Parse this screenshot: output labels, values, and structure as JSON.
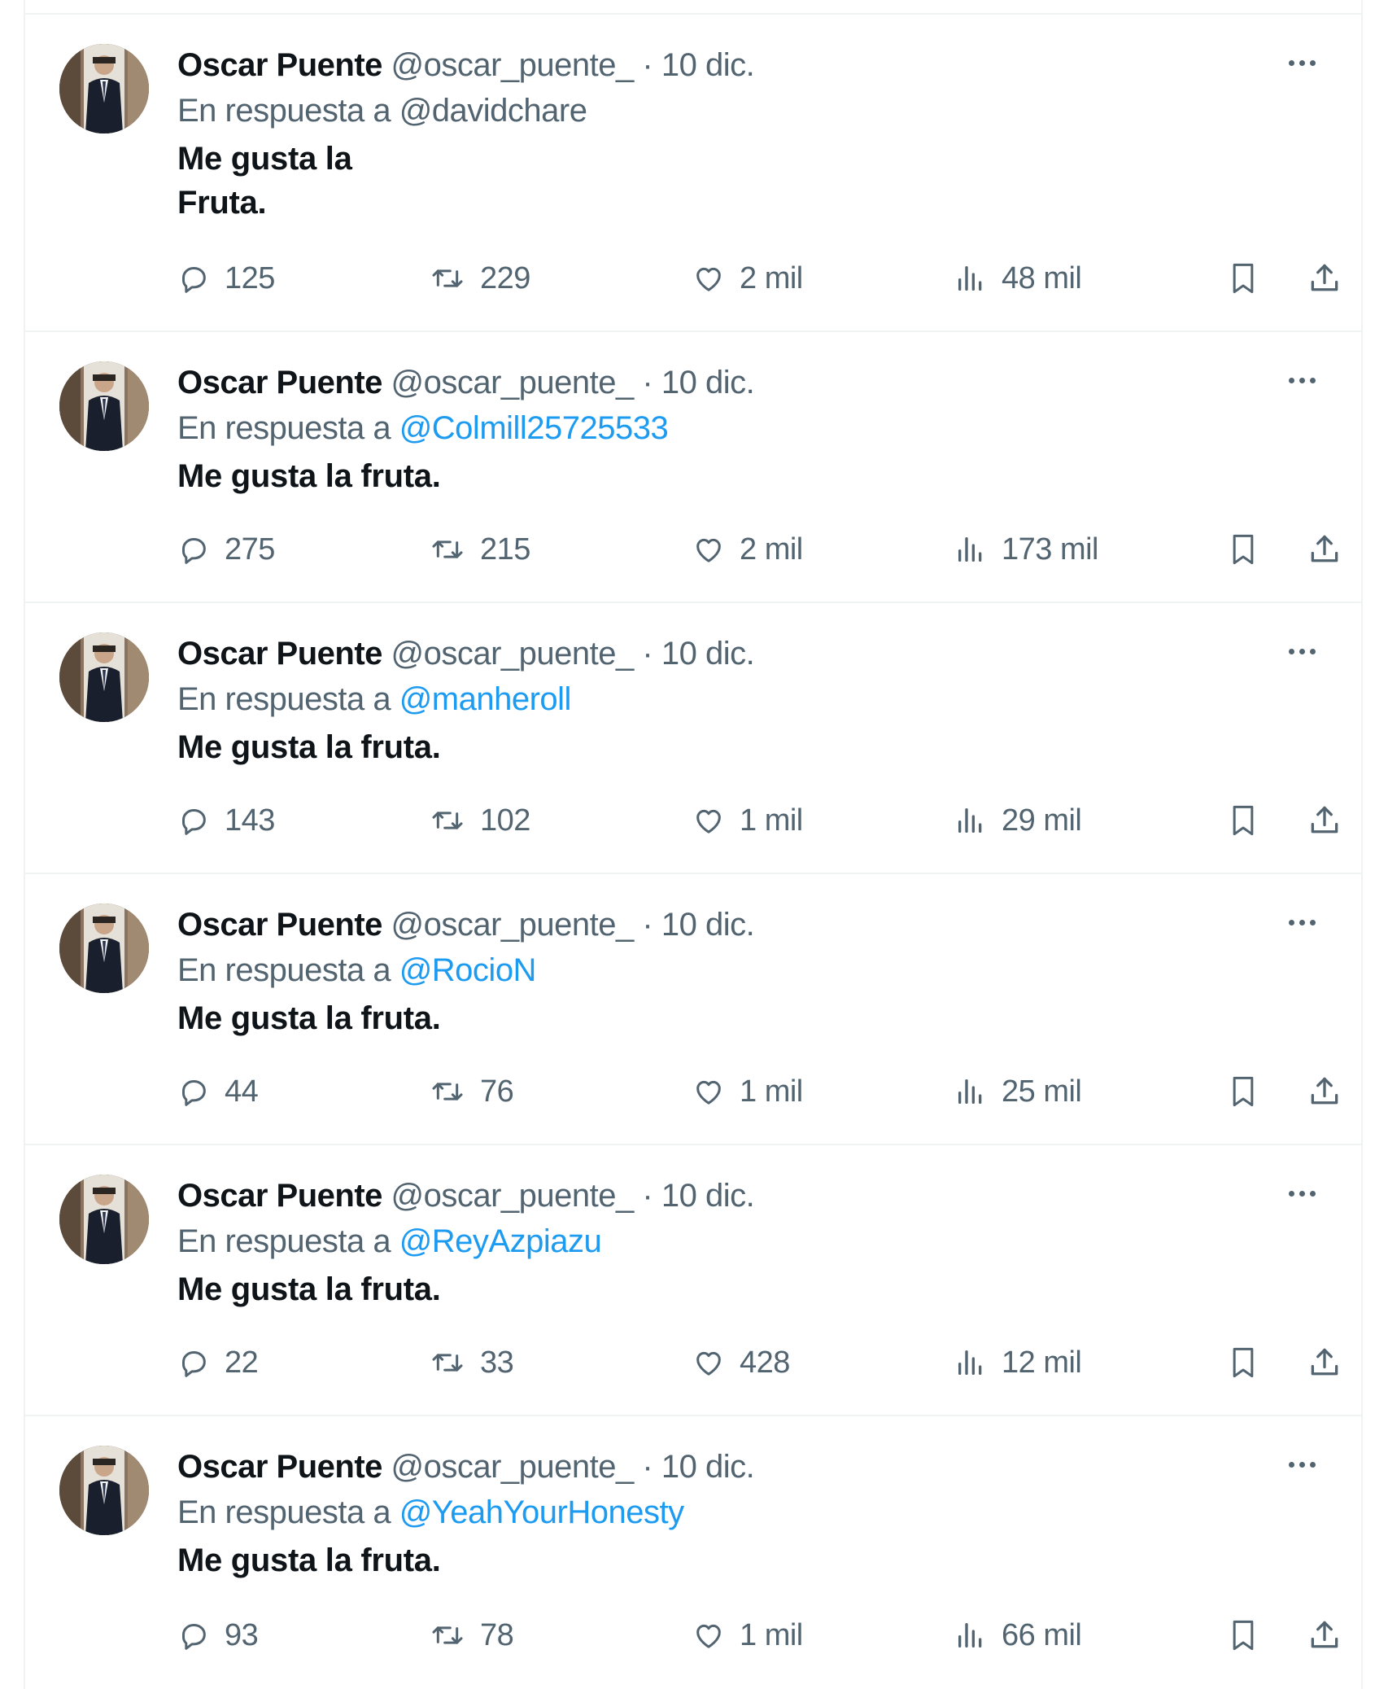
{
  "feed": {
    "tweets": [
      {
        "author_name": "Oscar Puente",
        "author_handle": "@oscar_puente_",
        "separator": "·",
        "date": "10 dic.",
        "reply_prefix": "En respuesta a",
        "reply_to": "@davidchare",
        "reply_to_is_link": false,
        "text": "Me gusta la\nFruta.",
        "replies": "125",
        "retweets": "229",
        "likes": "2 mil",
        "views": "48 mil"
      },
      {
        "author_name": "Oscar Puente",
        "author_handle": "@oscar_puente_",
        "separator": "·",
        "date": "10 dic.",
        "reply_prefix": "En respuesta a",
        "reply_to": "@Colmill25725533",
        "reply_to_is_link": true,
        "text": "Me gusta la fruta.",
        "replies": "275",
        "retweets": "215",
        "likes": "2 mil",
        "views": "173 mil"
      },
      {
        "author_name": "Oscar Puente",
        "author_handle": "@oscar_puente_",
        "separator": "·",
        "date": "10 dic.",
        "reply_prefix": "En respuesta a",
        "reply_to": "@manheroll",
        "reply_to_is_link": true,
        "text": "Me gusta la fruta.",
        "replies": "143",
        "retweets": "102",
        "likes": "1 mil",
        "views": "29 mil"
      },
      {
        "author_name": "Oscar Puente",
        "author_handle": "@oscar_puente_",
        "separator": "·",
        "date": "10 dic.",
        "reply_prefix": "En respuesta a",
        "reply_to": "@RocioN",
        "reply_to_is_link": true,
        "text": "Me gusta la fruta.",
        "replies": "44",
        "retweets": "76",
        "likes": "1 mil",
        "views": "25 mil"
      },
      {
        "author_name": "Oscar Puente",
        "author_handle": "@oscar_puente_",
        "separator": "·",
        "date": "10 dic.",
        "reply_prefix": "En respuesta a",
        "reply_to": "@ReyAzpiazu",
        "reply_to_is_link": true,
        "text": "Me gusta la fruta.",
        "replies": "22",
        "retweets": "33",
        "likes": "428",
        "views": "12 mil"
      },
      {
        "author_name": "Oscar Puente",
        "author_handle": "@oscar_puente_",
        "separator": "·",
        "date": "10 dic.",
        "reply_prefix": "En respuesta a",
        "reply_to": "@YeahYourHonesty",
        "reply_to_is_link": true,
        "text": "Me gusta la fruta.",
        "replies": "93",
        "retweets": "78",
        "likes": "1 mil",
        "views": "66 mil"
      }
    ]
  },
  "icons": {
    "more": "more-horizontal-icon",
    "reply": "reply-bubble-icon",
    "retweet": "retweet-icon",
    "like": "heart-icon",
    "views": "views-bar-chart-icon",
    "bookmark": "bookmark-icon",
    "share": "share-upload-icon"
  },
  "colors": {
    "text_primary": "#0f1419",
    "text_secondary": "#536471",
    "link": "#1d9bf0",
    "divider": "#eff3f4"
  }
}
